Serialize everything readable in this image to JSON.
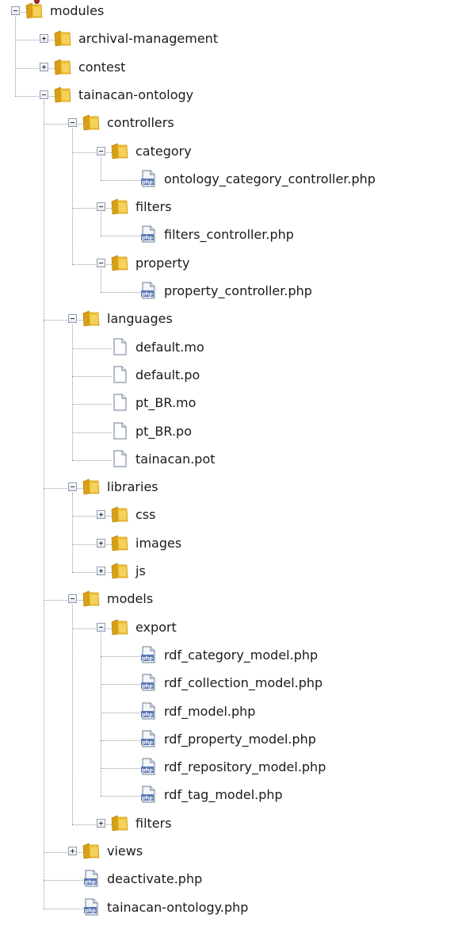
{
  "tree": [
    {
      "label": "modules",
      "type": "folder",
      "state": "expanded",
      "depth": 0
    },
    {
      "label": "archival-management",
      "type": "folder",
      "state": "collapsed",
      "depth": 1
    },
    {
      "label": "contest",
      "type": "folder",
      "state": "collapsed",
      "depth": 1
    },
    {
      "label": "tainacan-ontology",
      "type": "folder",
      "state": "expanded",
      "depth": 1
    },
    {
      "label": "controllers",
      "type": "folder",
      "state": "expanded",
      "depth": 2
    },
    {
      "label": "category",
      "type": "folder",
      "state": "expanded",
      "depth": 3
    },
    {
      "label": "ontology_category_controller.php",
      "type": "php",
      "depth": 4
    },
    {
      "label": "filters",
      "type": "folder",
      "state": "expanded",
      "depth": 3
    },
    {
      "label": "filters_controller.php",
      "type": "php",
      "depth": 4
    },
    {
      "label": "property",
      "type": "folder",
      "state": "expanded",
      "depth": 3
    },
    {
      "label": "property_controller.php",
      "type": "php",
      "depth": 4
    },
    {
      "label": "languages",
      "type": "folder",
      "state": "expanded",
      "depth": 2
    },
    {
      "label": "default.mo",
      "type": "file",
      "depth": 3
    },
    {
      "label": "default.po",
      "type": "file",
      "depth": 3
    },
    {
      "label": "pt_BR.mo",
      "type": "file",
      "depth": 3
    },
    {
      "label": "pt_BR.po",
      "type": "file",
      "depth": 3
    },
    {
      "label": "tainacan.pot",
      "type": "file",
      "depth": 3
    },
    {
      "label": "libraries",
      "type": "folder",
      "state": "expanded",
      "depth": 2
    },
    {
      "label": "css",
      "type": "folder",
      "state": "collapsed",
      "depth": 3
    },
    {
      "label": "images",
      "type": "folder",
      "state": "collapsed",
      "depth": 3
    },
    {
      "label": "js",
      "type": "folder",
      "state": "collapsed",
      "depth": 3
    },
    {
      "label": "models",
      "type": "folder",
      "state": "expanded",
      "depth": 2
    },
    {
      "label": "export",
      "type": "folder",
      "state": "expanded",
      "depth": 3
    },
    {
      "label": "rdf_category_model.php",
      "type": "php",
      "depth": 4
    },
    {
      "label": "rdf_collection_model.php",
      "type": "php",
      "depth": 4
    },
    {
      "label": "rdf_model.php",
      "type": "php",
      "depth": 4
    },
    {
      "label": "rdf_property_model.php",
      "type": "php",
      "depth": 4
    },
    {
      "label": "rdf_repository_model.php",
      "type": "php",
      "depth": 4
    },
    {
      "label": "rdf_tag_model.php",
      "type": "php",
      "depth": 4
    },
    {
      "label": "filters",
      "type": "folder",
      "state": "collapsed",
      "depth": 3
    },
    {
      "label": "views",
      "type": "folder",
      "state": "collapsed",
      "depth": 2
    },
    {
      "label": "deactivate.php",
      "type": "php",
      "depth": 2
    },
    {
      "label": "tainacan-ontology.php",
      "type": "php",
      "depth": 2
    }
  ],
  "icons": {
    "folder": "folder-icon",
    "php": "php-file-icon",
    "file": "file-icon"
  },
  "php_badge_text": "php",
  "colors": {
    "folder_fill": "#f1c232",
    "folder_dark": "#d89f18",
    "php_badge": "#5b77b3",
    "tree_line": "#9a9a9a"
  }
}
